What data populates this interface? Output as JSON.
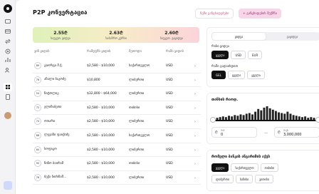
{
  "header": {
    "title": "P2P კონვერტაცია",
    "history_label": "ჩემი განცხადებები",
    "create_label": "+ განცხადების შექმნა"
  },
  "banner": [
    {
      "value": "2.55₾",
      "label": "საუკეთ. ყიდვა"
    },
    {
      "value": "2.63₾",
      "label": "საბაზრო კურსი"
    },
    {
      "value": "2.60₾",
      "label": "საუკეთ. გაყიდვა"
    }
  ],
  "table": {
    "headers": [
      "ვინ ყიდის",
      "რამდენს ყიდის",
      "მეთოდი",
      "რაში ყიდის",
      ""
    ],
    "rows": [
      {
        "n": "89",
        "name": "გიორგი შ.ჭ.",
        "range": "$2,580 - $10,000",
        "method": "საქართველო",
        "cur": "USD"
      },
      {
        "n": "76",
        "name": "ანალი ბაკოძე",
        "range": "$10,800",
        "method": "ლიბერთი",
        "cur": "USD"
      },
      {
        "n": "54",
        "name": "ნატოლიკ",
        "range": "$32,800 - $64,000",
        "method": "ლიბერთი",
        "cur": "USD"
      },
      {
        "n": "72",
        "name": "ელიზაბეთი",
        "range": "$2,580 - $10,000",
        "method": "თიბისი",
        "cur": "USD"
      },
      {
        "n": "74",
        "name": "ოთარი",
        "range": "$2,580 - $10,000",
        "method": "ლიბერთი",
        "cur": "USD"
      },
      {
        "n": "88",
        "name": "ლევანი ფაიქიძე",
        "range": "$2,580 - $10,000",
        "method": "საქართველო",
        "cur": "USD"
      },
      {
        "n": "64",
        "name": "სოფიკო",
        "range": "$2,580 - $10,000",
        "method": "ლიბერთი",
        "cur": "USD"
      },
      {
        "n": "90",
        "name": "ნინო ბაირამ",
        "range": "$2,580 - $10,000",
        "method": "თიბისი",
        "cur": "USD"
      },
      {
        "n": "76",
        "name": "ბექა ბიძინაშ...",
        "range": "$2,580 - $10,000",
        "method": "ლიბერთი",
        "cur": "USD"
      }
    ]
  },
  "filters": {
    "tabs": [
      "ყიდვა",
      "გაყიდვა"
    ],
    "tab_active": 0,
    "currency_label": "რისი ყიდვა",
    "currencies": [
      "ყველა",
      "USD",
      "EUR"
    ],
    "currency_active": 0,
    "pay_label": "რაში გადაიხდით",
    "pay_options": [
      "GEL",
      "ყველა",
      "ყველა"
    ],
    "pay_active": 0
  },
  "price": {
    "title": "თანხის რაოდ.",
    "min_label": "მინ",
    "min_value": "0",
    "max_label": "მაქს",
    "max_value": "3,000,000",
    "histogram": [
      3,
      4,
      5,
      4,
      6,
      5,
      7,
      6,
      8,
      7,
      9,
      10,
      8,
      12,
      16,
      14,
      18,
      20,
      17,
      15,
      13,
      11,
      10,
      9,
      12,
      9,
      7,
      6,
      5,
      4,
      5,
      3,
      4,
      3
    ]
  },
  "banks": {
    "title": "რომელი ბანკის ანგარიშის აქვს",
    "options": [
      "ყველა",
      "საქართველო",
      "თიბისი",
      "ლიბერთი",
      "ბაზისი",
      "ვითიბი"
    ],
    "active": 0
  },
  "colors": {
    "accent_pink": "#f8d6ea",
    "dark": "#111111"
  }
}
